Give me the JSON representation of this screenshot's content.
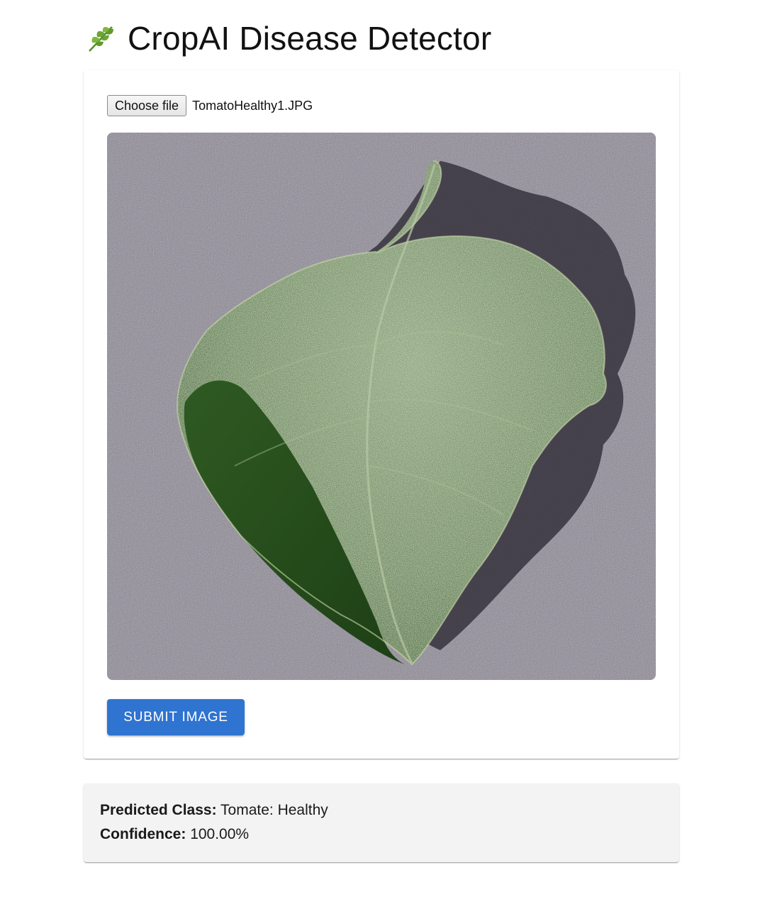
{
  "header": {
    "title": "CropAI Disease Detector",
    "icon": "leaf-icon"
  },
  "upload": {
    "choose_label": "Choose file",
    "file_name": "TomatoHealthy1.JPG",
    "preview_alt": "Uploaded leaf image"
  },
  "submit": {
    "label": "SUBMIT IMAGE",
    "color": "#2f74d0"
  },
  "result": {
    "class_label": "Predicted Class:",
    "class_value": "Tomate: Healthy",
    "confidence_label": "Confidence:",
    "confidence_value": "100.00%"
  }
}
